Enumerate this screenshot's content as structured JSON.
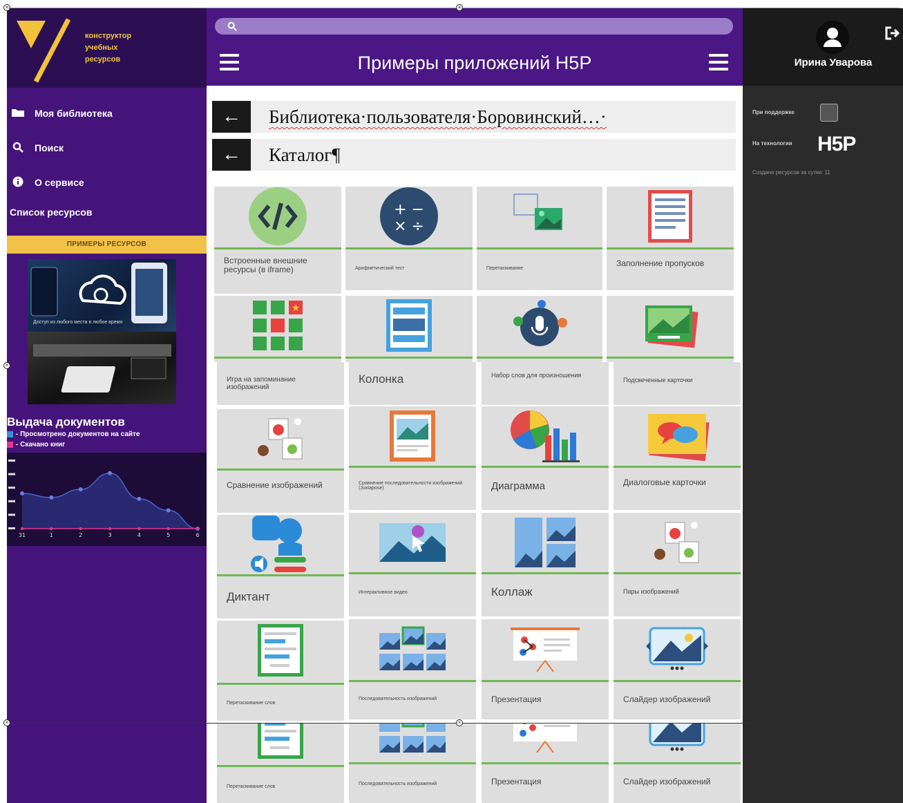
{
  "logo": {
    "line1": "конструктор",
    "line2": "учебных",
    "line3": "ресурсов"
  },
  "sidebar": {
    "items": [
      {
        "label": "Моя библиотека",
        "icon": "folder-icon"
      },
      {
        "label": "Поиск",
        "icon": "search-icon"
      },
      {
        "label": "О сервисе",
        "icon": "info-icon"
      }
    ],
    "resources_list": "Список ресурсов",
    "examples_bar": "ПРИМЕРЫ РЕСУРСОВ",
    "preview_caption": "Доступ из любого места в любое время",
    "docs_title": "Выдача документов",
    "legend": [
      {
        "label": "- Просмотрено документов на сайте",
        "color": "#3c8dde"
      },
      {
        "label": "- Скачано книг",
        "color": "#e0368f"
      }
    ]
  },
  "chart_data": {
    "type": "line",
    "x": [
      "31",
      "1",
      "2",
      "3",
      "4",
      "5",
      "6"
    ],
    "series": [
      {
        "values": [
          52,
          46,
          58,
          82,
          44,
          27,
          0
        ]
      },
      {
        "values": [
          0,
          0,
          0,
          0,
          0,
          0,
          0
        ]
      }
    ],
    "ylim": [
      0,
      100
    ],
    "colors": [
      "#3a4fb0",
      "#e0368f"
    ]
  },
  "header": {
    "title": "Примеры приложений H5P"
  },
  "breadcrumbs": [
    {
      "text": "Библиотека·пользователя·Боровинский…·"
    },
    {
      "text": "Каталог¶"
    }
  ],
  "tiles": [
    {
      "label": "Встроенные внешние ресурсы (в iframe)",
      "icon": "code-icon"
    },
    {
      "label": "Арифметический тест",
      "icon": "arithmetic-icon"
    },
    {
      "label": "Перетаскивание",
      "icon": "drag-image-icon"
    },
    {
      "label": "Заполнение пропусков",
      "icon": "fill-blanks-icon"
    },
    {
      "label": "Игра на запоминание изображений",
      "icon": "memory-grid-icon"
    },
    {
      "label": "Колонка",
      "icon": "column-icon"
    },
    {
      "label": "Набор слов для произношения",
      "icon": "microphone-icon"
    },
    {
      "label": "Подсвеченные карточки",
      "icon": "flashcards-icon"
    },
    {
      "label": "Сравнение изображений",
      "icon": "image-pairs-icon"
    },
    {
      "label": "Сравнение последовательности изображений (Juxtapose)",
      "icon": "image-sequence-icon"
    },
    {
      "label": "Диаграмма",
      "icon": "chart-icon"
    },
    {
      "label": "Диалоговые карточки",
      "icon": "dialog-cards-icon"
    },
    {
      "label": "Диктант",
      "icon": "dictation-icon"
    },
    {
      "label": "Интерактивное видео",
      "icon": "interactive-video-icon"
    },
    {
      "label": "Коллаж",
      "icon": "collage-icon"
    },
    {
      "label": "Пары изображений",
      "icon": "image-pairs-icon"
    },
    {
      "label": "Перетаскивание слов",
      "icon": "drag-words-icon"
    },
    {
      "label": "Последовательность изображений",
      "icon": "image-sequencing-icon"
    },
    {
      "label": "Презентация",
      "icon": "presentation-icon"
    },
    {
      "label": "Слайдер изображений",
      "icon": "image-slider-icon"
    },
    {
      "label": "Перетаскивание слов",
      "icon": "drag-words-icon"
    },
    {
      "label": "Последовательность изображений",
      "icon": "image-sequencing-icon"
    },
    {
      "label": "Презентация",
      "icon": "presentation-icon"
    },
    {
      "label": "Слайдер изображений",
      "icon": "image-slider-icon"
    }
  ],
  "right_panel": {
    "user_name": "Ирина Уварова",
    "support_label": "При поддержке",
    "tech_label": "На технологии",
    "tech_logo": "H5P",
    "created_label": "Создано ресурсов за сутки: 11"
  }
}
